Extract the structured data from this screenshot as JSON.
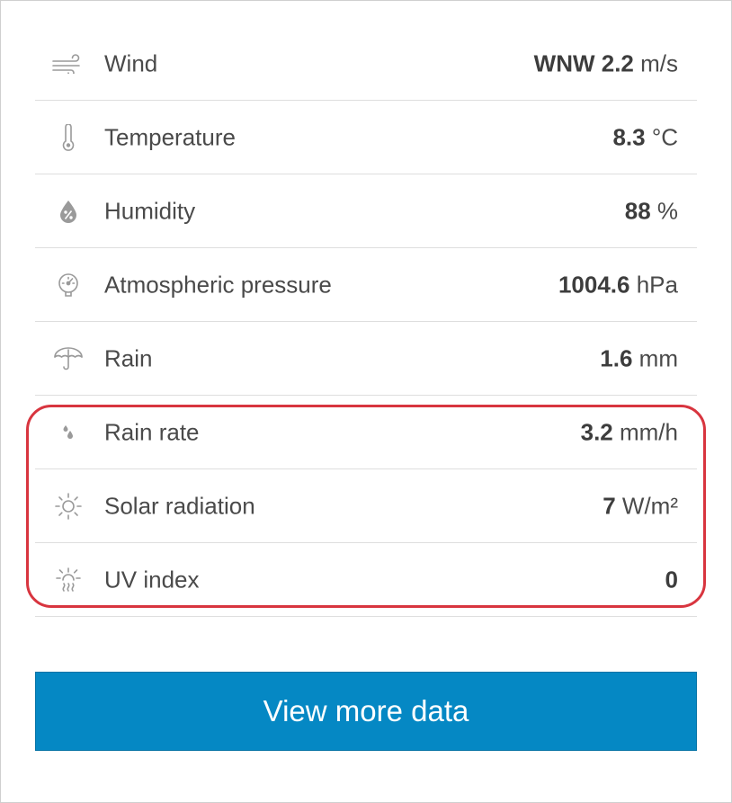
{
  "rows": [
    {
      "icon": "wind-icon",
      "label": "Wind",
      "value_num": "WNW 2.2",
      "value_unit": " m/s"
    },
    {
      "icon": "thermometer-icon",
      "label": "Temperature",
      "value_num": "8.3",
      "value_unit": " °C"
    },
    {
      "icon": "humidity-drop-icon",
      "label": "Humidity",
      "value_num": "88",
      "value_unit": " %"
    },
    {
      "icon": "pressure-gauge-icon",
      "label": "Atmospheric pressure",
      "value_num": "1004.6",
      "value_unit": " hPa"
    },
    {
      "icon": "umbrella-icon",
      "label": "Rain",
      "value_num": "1.6",
      "value_unit": " mm"
    },
    {
      "icon": "rain-drops-icon",
      "label": "Rain rate",
      "value_num": "3.2",
      "value_unit": " mm/h"
    },
    {
      "icon": "sun-icon",
      "label": "Solar radiation",
      "value_num": "7",
      "value_unit": " W/m²"
    },
    {
      "icon": "uv-sun-icon",
      "label": "UV index",
      "value_num": "0",
      "value_unit": ""
    }
  ],
  "button": {
    "label": "View more data"
  },
  "colors": {
    "accent": "#0588c4",
    "highlight": "#d8353f",
    "text": "#4a4a4a",
    "icon": "#9a9a9a",
    "divider": "#dedede"
  }
}
